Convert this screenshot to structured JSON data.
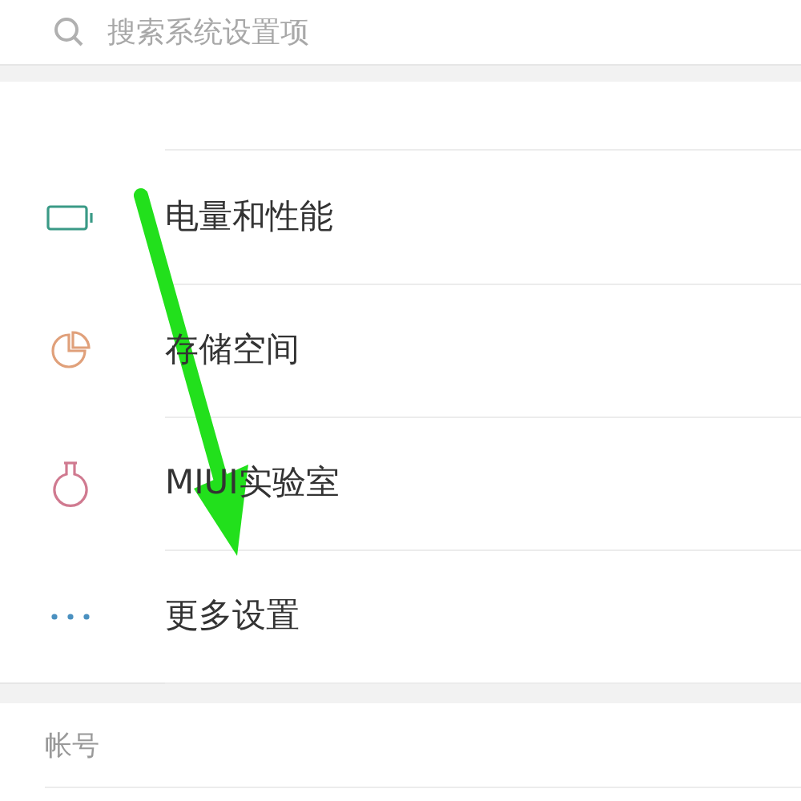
{
  "search": {
    "placeholder": "搜索系统设置项"
  },
  "items": [
    {
      "label": "电量和性能",
      "kind": "battery"
    },
    {
      "label": "存储空间",
      "kind": "storage"
    },
    {
      "label": "MIUI实验室",
      "kind": "lab"
    },
    {
      "label": "更多设置",
      "kind": "more"
    }
  ],
  "section": {
    "title": "帐号"
  }
}
